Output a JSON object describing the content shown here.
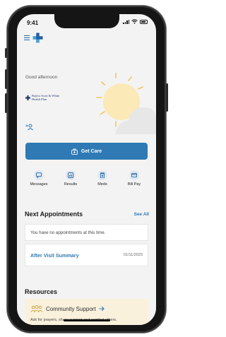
{
  "status_bar": {
    "time": "9:41"
  },
  "home": {
    "greeting": "Good afternoon",
    "plan_name": "Baylor Scott & White",
    "plan_sub": "Health Plan",
    "get_care_label": "Get Care",
    "quick_actions": [
      {
        "label": "Messages",
        "icon": "message-icon"
      },
      {
        "label": "Results",
        "icon": "chart-icon"
      },
      {
        "label": "Meds",
        "icon": "meds-icon"
      },
      {
        "label": "Bill Pay",
        "icon": "card-icon"
      }
    ]
  },
  "appointments": {
    "title": "Next Appointments",
    "see_all": "See All",
    "empty_message": "You have no appointments at this time.",
    "after_visit_label": "After Visit Summary",
    "after_visit_date": "01/11/2023"
  },
  "resources": {
    "title": "Resources",
    "community_title": "Community Support",
    "community_sub": "Ask for prayers, share support and comfort others."
  },
  "colors": {
    "accent": "#2f7ab4",
    "sun": "#fbe9b7",
    "cloud": "#e7e7e7",
    "community_bg": "#faf1dd"
  }
}
